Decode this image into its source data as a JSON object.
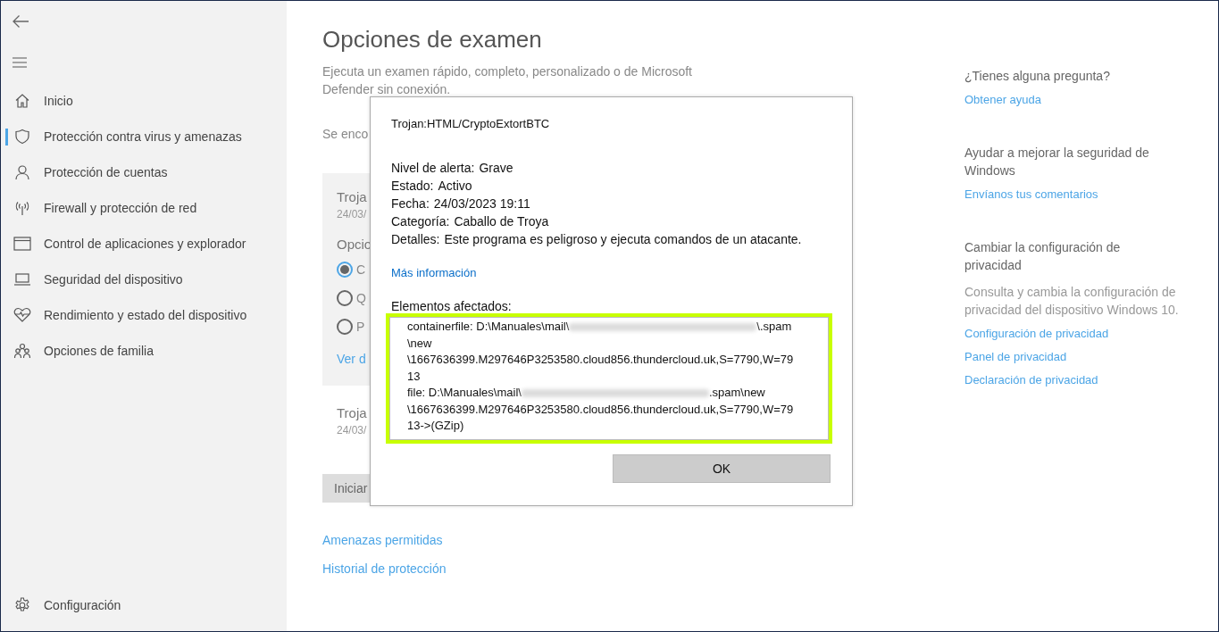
{
  "sidebar": {
    "items": [
      {
        "label": "Inicio",
        "selected": false
      },
      {
        "label": "Protección contra virus y amenazas",
        "selected": true
      },
      {
        "label": "Protección de cuentas",
        "selected": false
      },
      {
        "label": "Firewall y protección de red",
        "selected": false
      },
      {
        "label": "Control de aplicaciones y explorador",
        "selected": false
      },
      {
        "label": "Seguridad del dispositivo",
        "selected": false
      },
      {
        "label": "Rendimiento y estado del dispositivo",
        "selected": false
      },
      {
        "label": "Opciones de familia",
        "selected": false
      }
    ],
    "settings": "Configuración"
  },
  "main": {
    "title": "Opciones de examen",
    "description": "Ejecuta un examen rápido, completo, personalizado o de Microsoft Defender sin conexión.",
    "found": "Se enco",
    "card": {
      "threat": "Troja",
      "date": "24/03/",
      "options_label": "Opcio",
      "radios": [
        {
          "label": "C",
          "selected": true
        },
        {
          "label": "Q",
          "selected": false
        },
        {
          "label": "P",
          "selected": false
        }
      ],
      "link": "Ver d"
    },
    "threat2": {
      "threat": "Troja",
      "date": "24/03/"
    },
    "start_button": "Iniciar",
    "links": [
      "Amenazas permitidas",
      "Historial de protección"
    ]
  },
  "dialog": {
    "title": "Trojan:HTML/CryptoExtortBTC",
    "fields": [
      {
        "label": "Nivel de alerta:",
        "value": "Grave"
      },
      {
        "label": "Estado:",
        "value": "Activo"
      },
      {
        "label": "Fecha:",
        "value": "24/03/2023 19:11"
      },
      {
        "label": "Categoría:",
        "value": "Caballo de Troya"
      },
      {
        "label": "Detalles:",
        "value": "Este programa es peligroso y ejecuta comandos de un atacante."
      }
    ],
    "more_link": "Más información",
    "affected_label": "Elementos afectados:",
    "affected_lines": [
      {
        "before": "containerfile: D:\\Manuales\\mail\\",
        "redacted": true,
        "after": "\\.spam"
      },
      {
        "before": "\\new",
        "redacted": false
      },
      {
        "before": "\\1667636399.M297646P3253580.cloud856.thundercloud.uk,S=7790,W=79",
        "redacted": false
      },
      {
        "before": "13",
        "redacted": false
      },
      {
        "before": "file: D:\\Manuales\\mail\\",
        "redacted": true,
        "after": ".spam\\new"
      },
      {
        "before": "\\1667636399.M297646P3253580.cloud856.thundercloud.uk,S=7790,W=79",
        "redacted": false
      },
      {
        "before": "13->(GZip)",
        "redacted": false
      }
    ],
    "ok_button": "OK"
  },
  "aside": {
    "sections": [
      {
        "heading": "¿Tienes alguna pregunta?",
        "links": [
          "Obtener ayuda"
        ]
      },
      {
        "heading": "Ayudar a mejorar la seguridad de Windows",
        "links": [
          "Envíanos tus comentarios"
        ]
      },
      {
        "heading": "Cambiar la configuración de privacidad",
        "text": "Consulta y cambia la configuración de privacidad del dispositivo Windows 10.",
        "links": [
          "Configuración de privacidad",
          "Panel de privacidad",
          "Declaración de privacidad"
        ]
      }
    ]
  }
}
